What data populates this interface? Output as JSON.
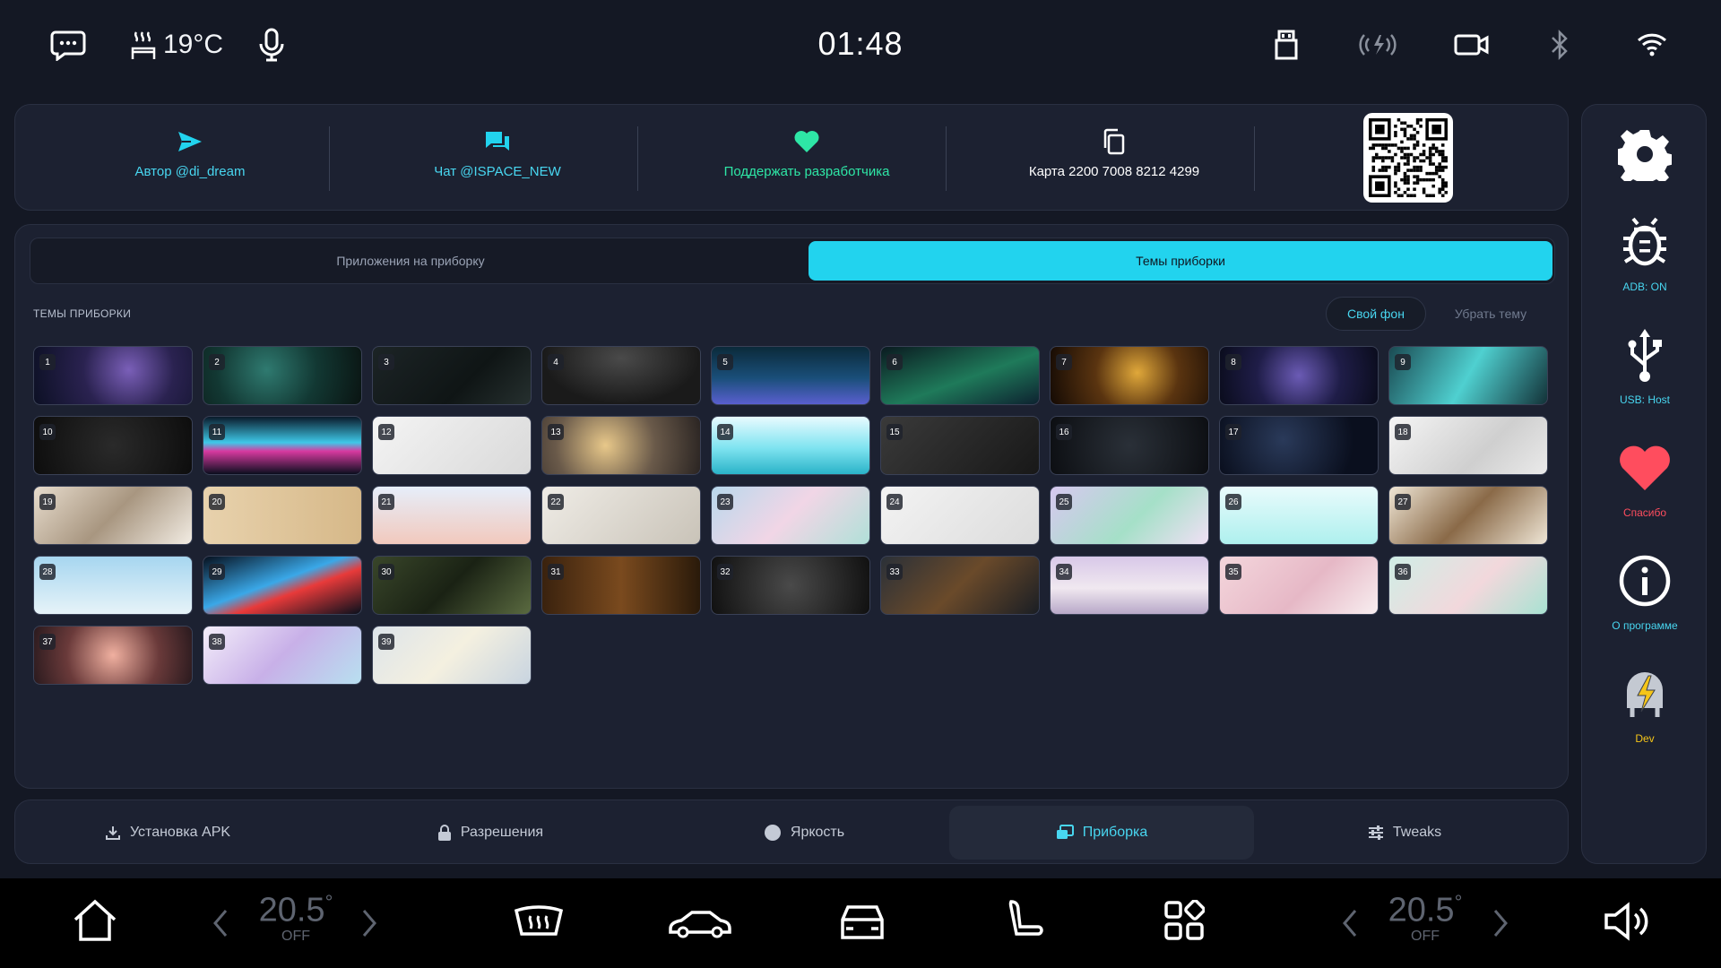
{
  "status": {
    "temperature": "19°C",
    "time": "01:48",
    "icons": [
      "message-icon",
      "seat-heat-icon",
      "mic-icon",
      "usb-drive-icon",
      "wireless-charge-icon",
      "camera-icon",
      "bluetooth-icon",
      "wifi-icon"
    ]
  },
  "links": {
    "author": "Автор @di_dream",
    "chat": "Чат @ISPACE_NEW",
    "support": "Поддержать разработчика",
    "card": "Карта 2200 7008 8212 4299"
  },
  "tabs": {
    "apps": "Приложения на приборку",
    "themes": "Темы приборки"
  },
  "themes_section": {
    "title": "ТЕМЫ ПРИБОРКИ",
    "own_bg": "Свой фон",
    "remove": "Убрать тему",
    "tiles": [
      "1",
      "2",
      "3",
      "4",
      "5",
      "6",
      "7",
      "8",
      "9",
      "10",
      "11",
      "12",
      "13",
      "14",
      "15",
      "16",
      "17",
      "18",
      "19",
      "20",
      "21",
      "22",
      "23",
      "24",
      "25",
      "26",
      "27",
      "28",
      "29",
      "30",
      "31",
      "32",
      "33",
      "34",
      "35",
      "36",
      "37",
      "38",
      "39"
    ]
  },
  "bottom_nav": {
    "apk": "Установка APK",
    "permissions": "Разрешения",
    "brightness": "Яркость",
    "dashboard": "Приборка",
    "tweaks": "Tweaks"
  },
  "side": {
    "adb": "ADB: ON",
    "usb": "USB: Host",
    "thanks": "Спасибо",
    "about": "О программе",
    "dev": "Dev"
  },
  "car": {
    "left_temp": "20.5",
    "left_state": "OFF",
    "right_temp": "20.5",
    "right_state": "OFF",
    "degree": "°"
  },
  "colors": {
    "accent": "#22d3ee",
    "panel": "#1c2131",
    "background": "#141824",
    "heart": "#ff4d5e",
    "support_green": "#2ee6a6"
  }
}
